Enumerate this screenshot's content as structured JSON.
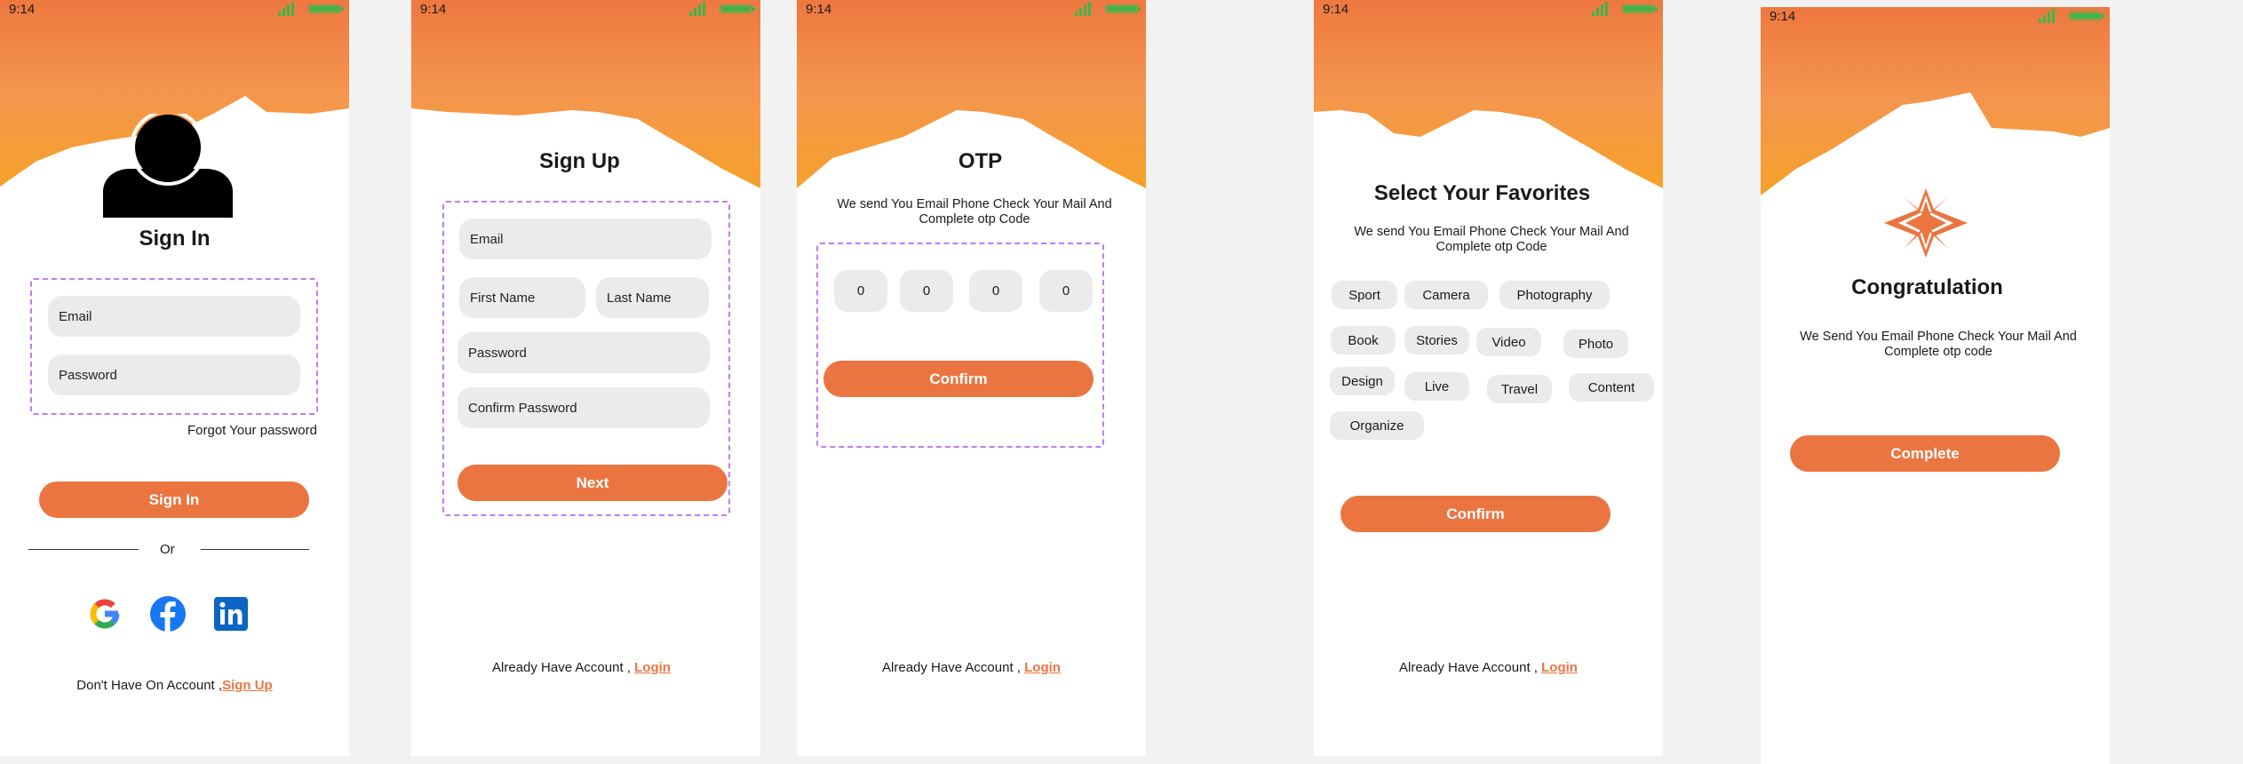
{
  "status": {
    "time": "9:14"
  },
  "colors": {
    "accent": "#eb7540",
    "gradient_top": "#ee7840",
    "gradient_mid": "#f4964e",
    "gradient_bottom": "#f6a12a",
    "field": "#ebebeb",
    "dashed_border": "#c27cf0"
  },
  "signin": {
    "title": "Sign In",
    "email_placeholder": "Email",
    "password_placeholder": "Password",
    "forgot": "Forgot Your password",
    "button": "Sign In",
    "or": "Or",
    "social": [
      "google-icon",
      "facebook-icon",
      "linkedin-icon"
    ],
    "footer_text": "Don't Have On Account ,",
    "footer_link": "Sign Up"
  },
  "signup": {
    "title": "Sign Up",
    "email": "Email",
    "first_name": "First Name",
    "last_name": "Last Name",
    "password": "Password",
    "confirm_password": "Confirm Password",
    "button": "Next",
    "footer_text": "Already  Have  Account ,",
    "footer_link": "Login"
  },
  "otp": {
    "title": "OTP",
    "description": "We send You Email Phone Check Your Mail And Complete otp Code",
    "digits": [
      "0",
      "0",
      "0",
      "0"
    ],
    "button": "Confirm",
    "footer_text": "Already  Have  Account ,",
    "footer_link": "Login"
  },
  "favorites": {
    "title": "Select Your Favorites",
    "description": "We send You Email Phone Check Your Mail And Complete otp Code",
    "chips": [
      "Sport",
      "Camera",
      "Photography",
      "Book",
      "Stories",
      "Video",
      "Photo",
      "Design",
      "Live",
      "Travel",
      "Content",
      "Organize"
    ],
    "button": "Confirm",
    "footer_text": "Already  Have  Account ,",
    "footer_link": "Login"
  },
  "congrats": {
    "title": "Congratulation",
    "description": "We Send You Email Phone Check Your Mail And Complete otp code",
    "button": "Complete"
  }
}
